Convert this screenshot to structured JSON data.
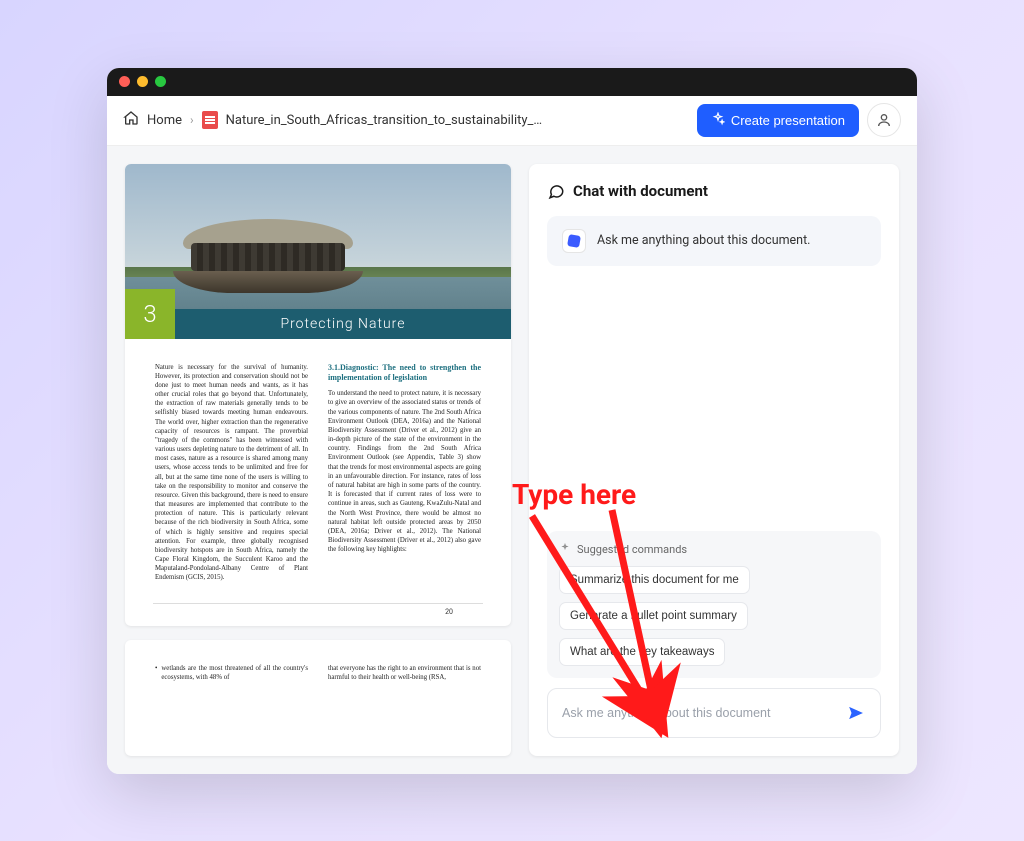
{
  "breadcrumb": {
    "home_label": "Home",
    "file_name": "Nature_in_South_Africas_transition_to_sustainability_A_sto..."
  },
  "topbar": {
    "create_label": "Create presentation"
  },
  "document": {
    "chapter_number": "3",
    "chapter_title": "Protecting Nature",
    "page_number": "20",
    "col1_text": "Nature is necessary for the survival of humanity. However, its protection and conservation should not be done just to meet human needs and wants, as it has other crucial roles that go beyond that. Unfortunately, the extraction of raw materials generally tends to be selfishly biased towards meeting human endeavours. The world over, higher extraction than the regenerative capacity of resources is rampant. The proverbial \"tragedy of the commons\" has been witnessed with various users depleting nature to the detriment of all. In most cases, nature as a resource is shared among many users, whose access tends to be unlimited and free for all, but at the same time none of the users is willing to take on the responsibility to monitor and conserve the resource. Given this background, there is need to ensure that measures are implemented that contribute to the protection of nature. This is particularly relevant because of the rich biodiversity in South Africa, some of which is highly sensitive and requires special attention. For example, three globally recognised biodiversity hotspots are in South Africa, namely the Cape Floral Kingdom, the Succulent Karoo and the Maputaland-Pondoland-Albany Centre of Plant Endemism (GCIS, 2015).",
    "col2_heading": "3.1.Diagnostic: The need to strengthen the implementation of legislation",
    "col2_text": "To understand the need to protect nature, it is necessary to give an overview of the associated status or trends of the various components of nature. The 2nd South Africa Environment Outlook (DEA, 2016a) and the National Biodiversity Assessment (Driver et al., 2012) give an in-depth picture of the state of the environment in the country. Findings from the 2nd South Africa Environment Outlook (see Appendix, Table 3) show that the trends for most environmental aspects are going in an unfavourable direction. For instance, rates of loss of natural habitat are high in some parts of the country. It is forecasted that if current rates of loss were to continue in areas, such as Gauteng, KwaZulu-Natal and the North West Province, there would be almost no natural habitat left outside protected areas by 2050 (DEA, 2016a; Driver et al., 2012). The National Biodiversity Assessment (Driver et al., 2012) also gave the following key highlights:",
    "page2_col1": "wetlands are the most threatened of all the country's ecosystems, with 48% of",
    "page2_col2": "that everyone has the right to an environment that is not harmful to their health or well-being (RSA,"
  },
  "chat": {
    "header": "Chat with document",
    "assistant_greeting": "Ask me anything about this document.",
    "suggested_label": "Suggested commands",
    "chips": [
      "Summarize this document for me",
      "Generate a bullet point summary",
      "What are the key takeaways"
    ],
    "input_placeholder": "Ask me anything about this document"
  },
  "annotation": {
    "label": "Type here"
  }
}
